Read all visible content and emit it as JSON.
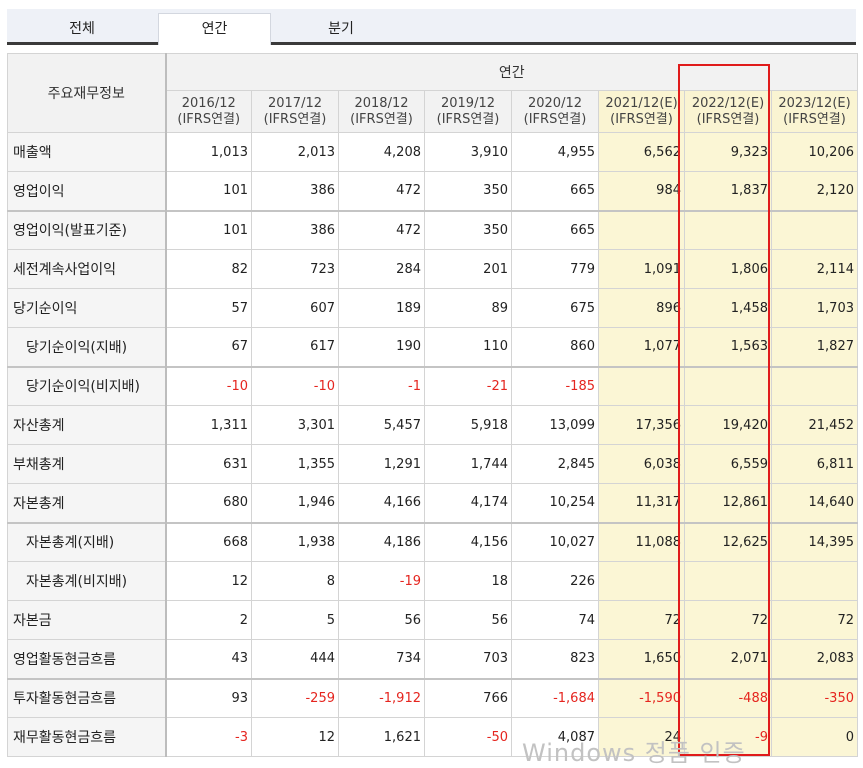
{
  "tabs": [
    "전체",
    "연간",
    "분기"
  ],
  "active_tab": 1,
  "corner_label": "주요재무정보",
  "group_label": "연간",
  "columns": [
    {
      "period": "2016/12",
      "basis": "(IFRS연결)",
      "estimate": false
    },
    {
      "period": "2017/12",
      "basis": "(IFRS연결)",
      "estimate": false
    },
    {
      "period": "2018/12",
      "basis": "(IFRS연결)",
      "estimate": false
    },
    {
      "period": "2019/12",
      "basis": "(IFRS연결)",
      "estimate": false
    },
    {
      "period": "2020/12",
      "basis": "(IFRS연결)",
      "estimate": false
    },
    {
      "period": "2021/12(E)",
      "basis": "(IFRS연결)",
      "estimate": true
    },
    {
      "period": "2022/12(E)",
      "basis": "(IFRS연결)",
      "estimate": true
    },
    {
      "period": "2023/12(E)",
      "basis": "(IFRS연결)",
      "estimate": true
    }
  ],
  "rows": [
    {
      "label": "매출액",
      "indent": false,
      "group_start": false,
      "values": [
        "1,013",
        "2,013",
        "4,208",
        "3,910",
        "4,955",
        "6,562",
        "9,323",
        "10,206"
      ]
    },
    {
      "label": "영업이익",
      "indent": false,
      "group_start": false,
      "values": [
        "101",
        "386",
        "472",
        "350",
        "665",
        "984",
        "1,837",
        "2,120"
      ]
    },
    {
      "label": "영업이익(발표기준)",
      "indent": false,
      "group_start": true,
      "values": [
        "101",
        "386",
        "472",
        "350",
        "665",
        "",
        "",
        ""
      ]
    },
    {
      "label": "세전계속사업이익",
      "indent": false,
      "group_start": false,
      "values": [
        "82",
        "723",
        "284",
        "201",
        "779",
        "1,091",
        "1,806",
        "2,114"
      ]
    },
    {
      "label": "당기순이익",
      "indent": false,
      "group_start": false,
      "values": [
        "57",
        "607",
        "189",
        "89",
        "675",
        "896",
        "1,458",
        "1,703"
      ]
    },
    {
      "label": "당기순이익(지배)",
      "indent": true,
      "group_start": false,
      "values": [
        "67",
        "617",
        "190",
        "110",
        "860",
        "1,077",
        "1,563",
        "1,827"
      ]
    },
    {
      "label": "당기순이익(비지배)",
      "indent": true,
      "group_start": true,
      "values": [
        "-10",
        "-10",
        "-1",
        "-21",
        "-185",
        "",
        "",
        ""
      ]
    },
    {
      "label": "자산총계",
      "indent": false,
      "group_start": false,
      "values": [
        "1,311",
        "3,301",
        "5,457",
        "5,918",
        "13,099",
        "17,356",
        "19,420",
        "21,452"
      ]
    },
    {
      "label": "부채총계",
      "indent": false,
      "group_start": false,
      "values": [
        "631",
        "1,355",
        "1,291",
        "1,744",
        "2,845",
        "6,038",
        "6,559",
        "6,811"
      ]
    },
    {
      "label": "자본총계",
      "indent": false,
      "group_start": false,
      "values": [
        "680",
        "1,946",
        "4,166",
        "4,174",
        "10,254",
        "11,317",
        "12,861",
        "14,640"
      ]
    },
    {
      "label": "자본총계(지배)",
      "indent": true,
      "group_start": true,
      "values": [
        "668",
        "1,938",
        "4,186",
        "4,156",
        "10,027",
        "11,088",
        "12,625",
        "14,395"
      ]
    },
    {
      "label": "자본총계(비지배)",
      "indent": true,
      "group_start": false,
      "values": [
        "12",
        "8",
        "-19",
        "18",
        "226",
        "",
        "",
        ""
      ]
    },
    {
      "label": "자본금",
      "indent": false,
      "group_start": false,
      "values": [
        "2",
        "5",
        "56",
        "56",
        "74",
        "72",
        "72",
        "72"
      ]
    },
    {
      "label": "영업활동현금흐름",
      "indent": false,
      "group_start": false,
      "values": [
        "43",
        "444",
        "734",
        "703",
        "823",
        "1,650",
        "2,071",
        "2,083"
      ]
    },
    {
      "label": "투자활동현금흐름",
      "indent": false,
      "group_start": true,
      "values": [
        "93",
        "-259",
        "-1,912",
        "766",
        "-1,684",
        "-1,590",
        "-488",
        "-350"
      ]
    },
    {
      "label": "재무활동현금흐름",
      "indent": false,
      "group_start": false,
      "values": [
        "-3",
        "12",
        "1,621",
        "-50",
        "4,087",
        "24",
        "-9",
        "0"
      ]
    }
  ],
  "watermark": "Windows 정품 인증",
  "colors": {
    "negative": "#e5251f",
    "estimate_bg": "#fbf6d5",
    "highlight": "#e01b1b"
  }
}
